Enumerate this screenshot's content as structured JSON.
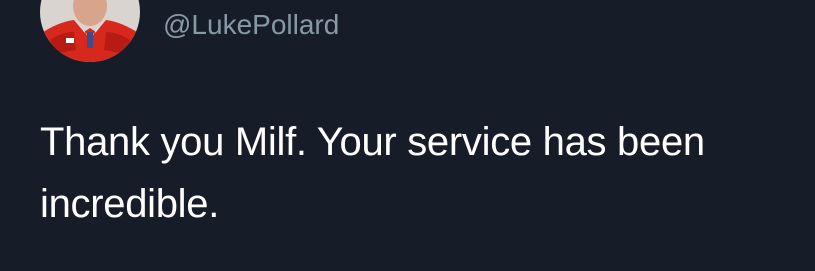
{
  "tweet": {
    "avatar_icon": "profile-photo",
    "handle": "@LukePollard",
    "text": "Thank you Milf. Your service has been incredible."
  },
  "colors": {
    "background": "#161d29",
    "handle": "#8899a6",
    "text": "#ffffff"
  }
}
